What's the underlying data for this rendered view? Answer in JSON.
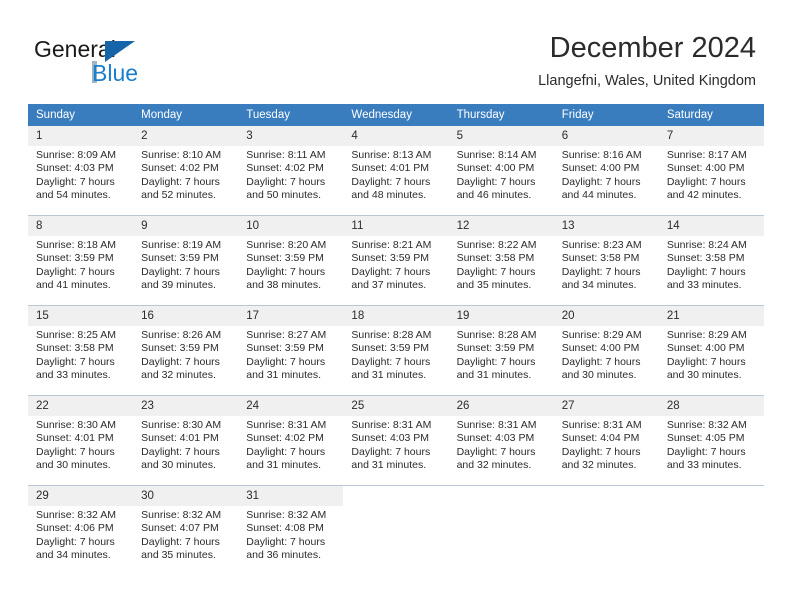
{
  "brand": {
    "name_part1": "General",
    "name_part2": "Blue",
    "triangle_color": "#1565a8",
    "blue_text_color": "#1b7fcc"
  },
  "header": {
    "month_title": "December 2024",
    "location": "Llangefni, Wales, United Kingdom"
  },
  "colors": {
    "header_row_bg": "#3a7dbf",
    "header_row_text": "#ffffff",
    "daynum_band_bg": "#f0f0f0",
    "row_divider": "#b9c6d4",
    "body_text": "#2b2b2b"
  },
  "weekdays": [
    "Sunday",
    "Monday",
    "Tuesday",
    "Wednesday",
    "Thursday",
    "Friday",
    "Saturday"
  ],
  "weeks": [
    [
      {
        "day": "1",
        "sunrise": "Sunrise: 8:09 AM",
        "sunset": "Sunset: 4:03 PM",
        "daylight_line1": "Daylight: 7 hours",
        "daylight_line2": "and 54 minutes."
      },
      {
        "day": "2",
        "sunrise": "Sunrise: 8:10 AM",
        "sunset": "Sunset: 4:02 PM",
        "daylight_line1": "Daylight: 7 hours",
        "daylight_line2": "and 52 minutes."
      },
      {
        "day": "3",
        "sunrise": "Sunrise: 8:11 AM",
        "sunset": "Sunset: 4:02 PM",
        "daylight_line1": "Daylight: 7 hours",
        "daylight_line2": "and 50 minutes."
      },
      {
        "day": "4",
        "sunrise": "Sunrise: 8:13 AM",
        "sunset": "Sunset: 4:01 PM",
        "daylight_line1": "Daylight: 7 hours",
        "daylight_line2": "and 48 minutes."
      },
      {
        "day": "5",
        "sunrise": "Sunrise: 8:14 AM",
        "sunset": "Sunset: 4:00 PM",
        "daylight_line1": "Daylight: 7 hours",
        "daylight_line2": "and 46 minutes."
      },
      {
        "day": "6",
        "sunrise": "Sunrise: 8:16 AM",
        "sunset": "Sunset: 4:00 PM",
        "daylight_line1": "Daylight: 7 hours",
        "daylight_line2": "and 44 minutes."
      },
      {
        "day": "7",
        "sunrise": "Sunrise: 8:17 AM",
        "sunset": "Sunset: 4:00 PM",
        "daylight_line1": "Daylight: 7 hours",
        "daylight_line2": "and 42 minutes."
      }
    ],
    [
      {
        "day": "8",
        "sunrise": "Sunrise: 8:18 AM",
        "sunset": "Sunset: 3:59 PM",
        "daylight_line1": "Daylight: 7 hours",
        "daylight_line2": "and 41 minutes."
      },
      {
        "day": "9",
        "sunrise": "Sunrise: 8:19 AM",
        "sunset": "Sunset: 3:59 PM",
        "daylight_line1": "Daylight: 7 hours",
        "daylight_line2": "and 39 minutes."
      },
      {
        "day": "10",
        "sunrise": "Sunrise: 8:20 AM",
        "sunset": "Sunset: 3:59 PM",
        "daylight_line1": "Daylight: 7 hours",
        "daylight_line2": "and 38 minutes."
      },
      {
        "day": "11",
        "sunrise": "Sunrise: 8:21 AM",
        "sunset": "Sunset: 3:59 PM",
        "daylight_line1": "Daylight: 7 hours",
        "daylight_line2": "and 37 minutes."
      },
      {
        "day": "12",
        "sunrise": "Sunrise: 8:22 AM",
        "sunset": "Sunset: 3:58 PM",
        "daylight_line1": "Daylight: 7 hours",
        "daylight_line2": "and 35 minutes."
      },
      {
        "day": "13",
        "sunrise": "Sunrise: 8:23 AM",
        "sunset": "Sunset: 3:58 PM",
        "daylight_line1": "Daylight: 7 hours",
        "daylight_line2": "and 34 minutes."
      },
      {
        "day": "14",
        "sunrise": "Sunrise: 8:24 AM",
        "sunset": "Sunset: 3:58 PM",
        "daylight_line1": "Daylight: 7 hours",
        "daylight_line2": "and 33 minutes."
      }
    ],
    [
      {
        "day": "15",
        "sunrise": "Sunrise: 8:25 AM",
        "sunset": "Sunset: 3:58 PM",
        "daylight_line1": "Daylight: 7 hours",
        "daylight_line2": "and 33 minutes."
      },
      {
        "day": "16",
        "sunrise": "Sunrise: 8:26 AM",
        "sunset": "Sunset: 3:59 PM",
        "daylight_line1": "Daylight: 7 hours",
        "daylight_line2": "and 32 minutes."
      },
      {
        "day": "17",
        "sunrise": "Sunrise: 8:27 AM",
        "sunset": "Sunset: 3:59 PM",
        "daylight_line1": "Daylight: 7 hours",
        "daylight_line2": "and 31 minutes."
      },
      {
        "day": "18",
        "sunrise": "Sunrise: 8:28 AM",
        "sunset": "Sunset: 3:59 PM",
        "daylight_line1": "Daylight: 7 hours",
        "daylight_line2": "and 31 minutes."
      },
      {
        "day": "19",
        "sunrise": "Sunrise: 8:28 AM",
        "sunset": "Sunset: 3:59 PM",
        "daylight_line1": "Daylight: 7 hours",
        "daylight_line2": "and 31 minutes."
      },
      {
        "day": "20",
        "sunrise": "Sunrise: 8:29 AM",
        "sunset": "Sunset: 4:00 PM",
        "daylight_line1": "Daylight: 7 hours",
        "daylight_line2": "and 30 minutes."
      },
      {
        "day": "21",
        "sunrise": "Sunrise: 8:29 AM",
        "sunset": "Sunset: 4:00 PM",
        "daylight_line1": "Daylight: 7 hours",
        "daylight_line2": "and 30 minutes."
      }
    ],
    [
      {
        "day": "22",
        "sunrise": "Sunrise: 8:30 AM",
        "sunset": "Sunset: 4:01 PM",
        "daylight_line1": "Daylight: 7 hours",
        "daylight_line2": "and 30 minutes."
      },
      {
        "day": "23",
        "sunrise": "Sunrise: 8:30 AM",
        "sunset": "Sunset: 4:01 PM",
        "daylight_line1": "Daylight: 7 hours",
        "daylight_line2": "and 30 minutes."
      },
      {
        "day": "24",
        "sunrise": "Sunrise: 8:31 AM",
        "sunset": "Sunset: 4:02 PM",
        "daylight_line1": "Daylight: 7 hours",
        "daylight_line2": "and 31 minutes."
      },
      {
        "day": "25",
        "sunrise": "Sunrise: 8:31 AM",
        "sunset": "Sunset: 4:03 PM",
        "daylight_line1": "Daylight: 7 hours",
        "daylight_line2": "and 31 minutes."
      },
      {
        "day": "26",
        "sunrise": "Sunrise: 8:31 AM",
        "sunset": "Sunset: 4:03 PM",
        "daylight_line1": "Daylight: 7 hours",
        "daylight_line2": "and 32 minutes."
      },
      {
        "day": "27",
        "sunrise": "Sunrise: 8:31 AM",
        "sunset": "Sunset: 4:04 PM",
        "daylight_line1": "Daylight: 7 hours",
        "daylight_line2": "and 32 minutes."
      },
      {
        "day": "28",
        "sunrise": "Sunrise: 8:32 AM",
        "sunset": "Sunset: 4:05 PM",
        "daylight_line1": "Daylight: 7 hours",
        "daylight_line2": "and 33 minutes."
      }
    ],
    [
      {
        "day": "29",
        "sunrise": "Sunrise: 8:32 AM",
        "sunset": "Sunset: 4:06 PM",
        "daylight_line1": "Daylight: 7 hours",
        "daylight_line2": "and 34 minutes."
      },
      {
        "day": "30",
        "sunrise": "Sunrise: 8:32 AM",
        "sunset": "Sunset: 4:07 PM",
        "daylight_line1": "Daylight: 7 hours",
        "daylight_line2": "and 35 minutes."
      },
      {
        "day": "31",
        "sunrise": "Sunrise: 8:32 AM",
        "sunset": "Sunset: 4:08 PM",
        "daylight_line1": "Daylight: 7 hours",
        "daylight_line2": "and 36 minutes."
      },
      {
        "day": "",
        "sunrise": "",
        "sunset": "",
        "daylight_line1": "",
        "daylight_line2": ""
      },
      {
        "day": "",
        "sunrise": "",
        "sunset": "",
        "daylight_line1": "",
        "daylight_line2": ""
      },
      {
        "day": "",
        "sunrise": "",
        "sunset": "",
        "daylight_line1": "",
        "daylight_line2": ""
      },
      {
        "day": "",
        "sunrise": "",
        "sunset": "",
        "daylight_line1": "",
        "daylight_line2": ""
      }
    ]
  ]
}
